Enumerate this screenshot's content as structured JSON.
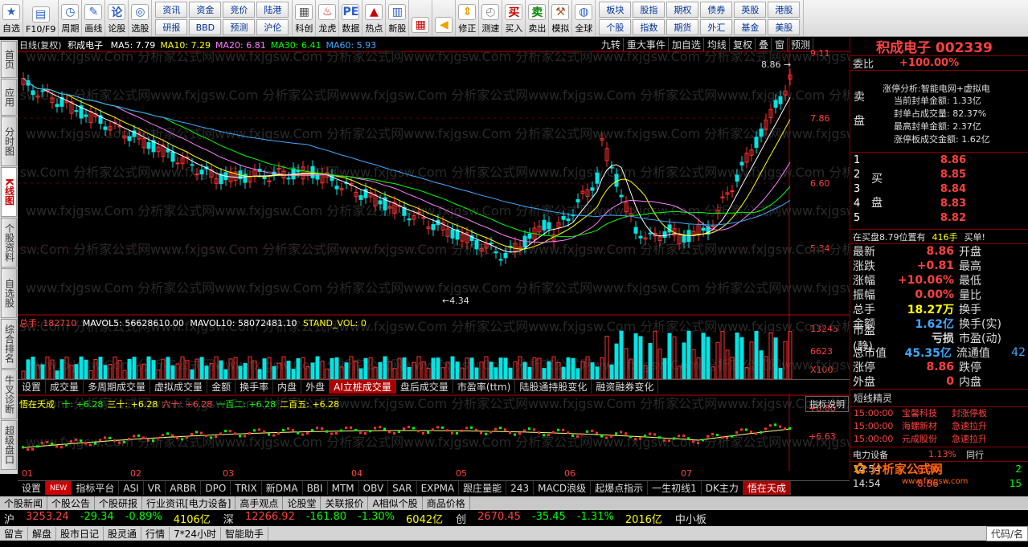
{
  "toolbar": {
    "buttons": [
      {
        "label": "自选",
        "icon": "star-icon",
        "color": "#2b5fc8"
      },
      {
        "label": "F10/F9",
        "icon": "document-icon",
        "color": "#2b5fc8"
      },
      {
        "label": "周期",
        "icon": "clock-icon",
        "color": "#2b5fc8"
      },
      {
        "label": "画线",
        "icon": "pencil-icon",
        "color": "#2b5fc8"
      },
      {
        "label": "论股",
        "icon": "forum-icon",
        "color": "#2b5fc8"
      },
      {
        "label": "选股",
        "icon": "chart-search-icon",
        "color": "#2b5fc8"
      }
    ],
    "grid": [
      "资讯",
      "资金",
      "竞价",
      "陆港",
      "研报",
      "BBD",
      "预测",
      "沪伦"
    ],
    "buttons2": [
      {
        "label": "科创",
        "icon": "chart-icon",
        "color": "#555"
      },
      {
        "label": "龙虎",
        "icon": "dragon-icon",
        "color": "#c00"
      },
      {
        "label": "数据",
        "icon": "pe-icon",
        "color": "#2b5fc8"
      },
      {
        "label": "热点",
        "icon": "hot-icon",
        "color": "#c00"
      },
      {
        "label": "新股",
        "icon": "ipo-icon",
        "color": "#2b5fc8"
      }
    ],
    "buttons3": [
      {
        "label": "",
        "icon": "color-grid-icon",
        "color": "#c00"
      },
      {
        "label": "",
        "icon": "back-arrow-icon",
        "color": "#f0a000"
      },
      {
        "label": "修正",
        "icon": "up-down-arrows-icon",
        "color": "#f0a000"
      },
      {
        "label": "测速",
        "icon": "timer-icon",
        "color": "#888"
      },
      {
        "label": "买入",
        "icon": "buy-icon",
        "color": "#c00"
      },
      {
        "label": "卖出",
        "icon": "sell-icon",
        "color": "#080"
      },
      {
        "label": "模拟",
        "icon": "hammer-icon",
        "color": "#a52"
      },
      {
        "label": "全球",
        "icon": "globe-icon",
        "color": "#2b5fc8"
      }
    ],
    "grid2": [
      "板块",
      "股指",
      "期权",
      "债券",
      "英股",
      "港股",
      "个股",
      "指数",
      "期货",
      "外汇",
      "基金",
      "美股"
    ]
  },
  "lefttabs": [
    "首页",
    "应用",
    "分时图",
    "K线图",
    "个股资料",
    "自选股",
    "综合排名",
    "牛叉诊断",
    "超级盘口"
  ],
  "chart": {
    "period": "日线(复权)",
    "name": "积成电子",
    "ma": [
      {
        "label": "MA5: 7.79",
        "color": "#ffffff"
      },
      {
        "label": "MA10: 7.29",
        "color": "#ffff00"
      },
      {
        "label": "MA20: 6.81",
        "color": "#ff80ff"
      },
      {
        "label": "MA30: 6.41",
        "color": "#00ff00"
      },
      {
        "label": "MA60: 5.93",
        "color": "#3fa9ff"
      }
    ],
    "buttons": [
      "九转",
      "重大事件",
      "加自选",
      "均线",
      "复权",
      "叠",
      "窗",
      "预测"
    ],
    "price_axis": [
      "9.11",
      "7.86",
      "6.60",
      "5.34"
    ],
    "high_label": "8.86",
    "low_label": "4.34",
    "vol_header": "总手: 182710",
    "vol_ma5": "MAVOL5: 56628610.00",
    "vol_ma10": "MAVOL10: 58072481.10",
    "vol_std": "STAND_VOL: 0",
    "vol_axis": [
      "13245",
      "6623",
      "X100"
    ],
    "ind_header": "悟在天成",
    "ind_vals": [
      "十: +6.28",
      "三十: +6.28",
      "六十: +6.28",
      "一百二: +6.28",
      "二百五: +6.28"
    ],
    "ind_axis": [
      "+8.86",
      "+6.63"
    ],
    "ind_help": "指标说明",
    "months": [
      "01",
      "02",
      "03",
      "04",
      "05",
      "06",
      "07"
    ],
    "watermark": "www.fxjgsw.Com 分析家公式网"
  },
  "indtabs": [
    "设置",
    "成交量",
    "多周期成交量",
    "虚拟成交量",
    "金额",
    "换手率",
    "内盘",
    "外盘",
    "AI立桩成交量",
    "盘后成交量",
    "市盈率(ttm)",
    "陆股通持股变化",
    "融资融券变化"
  ],
  "indtabs2": [
    "设置",
    "NEW",
    "指标平台",
    "ASI",
    "VR",
    "ARBR",
    "DPO",
    "TRIX",
    "新DMA",
    "BBI",
    "MTM",
    "OBV",
    "SAR",
    "EXPMA",
    "跟庄量能",
    "243",
    "MACD浪级",
    "起爆点指示",
    "一生初线1",
    "DK主力",
    "悟在天成"
  ],
  "rp": {
    "title": "积成电子 002339",
    "weibi_label": "委比",
    "weibi": "+100.00%",
    "sell": "卖",
    "sell2": "盘",
    "buy": "买",
    "buy2": "盘",
    "analysis": "涨停分析:智能电网+虚拟电",
    "analysis_rows": [
      "当前封单金额: 1.33亿",
      "封单占成交量: 82.37%",
      "最高封单金额: 2.37亿",
      "涨停板成交金额: 1.62亿"
    ],
    "bids": [
      {
        "n": "1",
        "p": "8.86",
        "v": ""
      },
      {
        "n": "2",
        "p": "8.85",
        "v": ""
      },
      {
        "n": "3",
        "p": "8.84",
        "v": ""
      },
      {
        "n": "4",
        "p": "8.83",
        "v": ""
      },
      {
        "n": "5",
        "p": "8.82",
        "v": ""
      }
    ],
    "zaimai": "在买盘8.79位置有",
    "zaimai_v": "416手",
    "zaimai_r": "买单!",
    "quotes": [
      [
        "最新",
        "8.86",
        "开盘",
        ""
      ],
      [
        "涨跌",
        "+0.81",
        "最高",
        ""
      ],
      [
        "涨幅",
        "+10.06%",
        "最低",
        ""
      ],
      [
        "振幅",
        "0.00%",
        "量比",
        ""
      ],
      [
        "总手",
        "18.27万",
        "换手",
        ""
      ],
      [
        "金额",
        "1.62亿",
        "换手(实)",
        ""
      ],
      [
        "市盈(静)",
        "亏损",
        "市盈(动)",
        ""
      ],
      [
        "总市值",
        "45.35亿",
        "流通值",
        "42"
      ],
      [
        "涨停",
        "8.86",
        "跌停",
        ""
      ],
      [
        "外盘",
        "0",
        "内盘",
        ""
      ]
    ],
    "elves_title": "短线精灵",
    "elves": [
      [
        "15:00:00",
        "宝馨科技",
        "封涨停板"
      ],
      [
        "15:00:00",
        "海螺新材",
        "急速拉升"
      ],
      [
        "15:00:00",
        "元成股份",
        "急速拉升"
      ]
    ],
    "sector": "电力设备",
    "sector_pct": "1.13%",
    "sector_peer": "同行",
    "ticks": [
      [
        "14:54",
        "8.86",
        "2"
      ],
      [
        "14:54",
        "8.86",
        "15"
      ]
    ],
    "brand": "分析家公式网",
    "brand_url": "www.fxjgsw.com"
  },
  "bottom": {
    "tabs": [
      "个股新闻",
      "个股公告",
      "个股研报",
      "行业资讯[电力设备]",
      "高手观点",
      "论股堂",
      "关联报价",
      "A相似个股",
      "商品价格"
    ],
    "ticker": [
      [
        "沪",
        "3253.24",
        "-29.34",
        "-0.89%",
        "4106亿"
      ],
      [
        "深",
        "12266.92",
        "-161.80",
        "-1.30%",
        "6042亿"
      ],
      [
        "创",
        "2670.45",
        "-35.45",
        "-1.31%",
        "2016亿"
      ]
    ],
    "ticker_tail": "中小板",
    "status": [
      "留言",
      "解盘",
      "股市日记",
      "股灵通",
      "行情",
      "7*24小时",
      "智能助手"
    ],
    "code_hint": "代码/名"
  }
}
